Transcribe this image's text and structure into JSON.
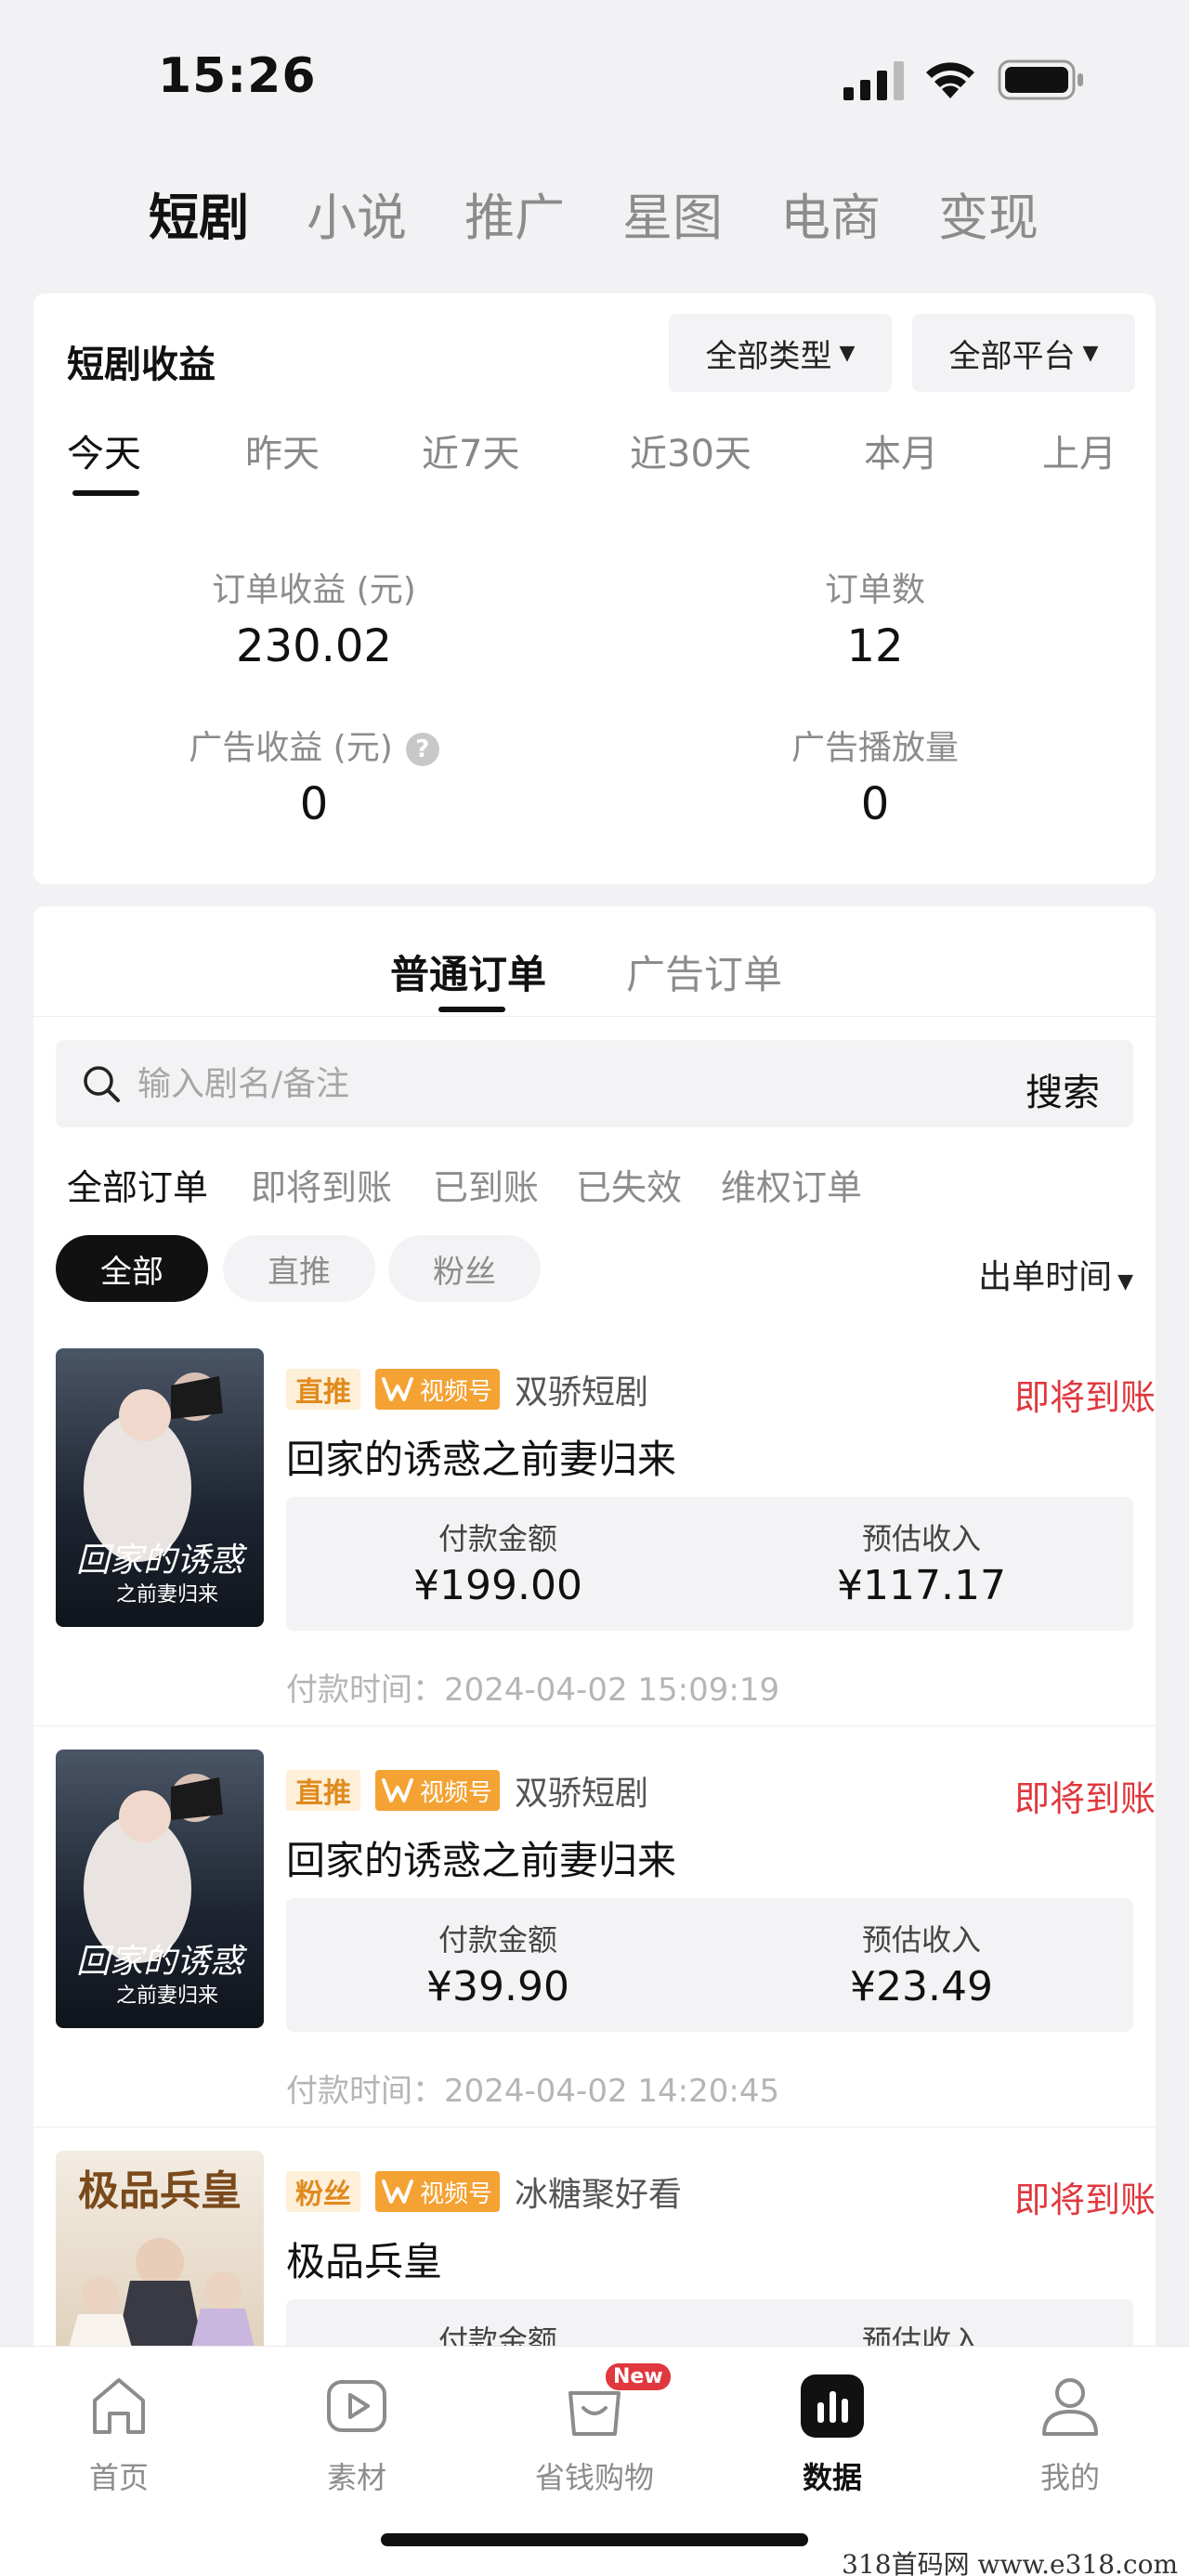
{
  "status_bar": {
    "time": "15:26"
  },
  "top_tabs": [
    "短剧",
    "小说",
    "推广",
    "星图",
    "电商",
    "变现"
  ],
  "earnings": {
    "title": "短剧收益",
    "type_filter": "全部类型",
    "platform_filter": "全部平台",
    "periods": [
      "今天",
      "昨天",
      "近7天",
      "近30天",
      "本月",
      "上月"
    ],
    "order_income_label": "订单收益 (元)",
    "order_income_value": "230.02",
    "order_count_label": "订单数",
    "order_count_value": "12",
    "ad_income_label": "广告收益 (元)",
    "ad_income_value": "0",
    "ad_plays_label": "广告播放量",
    "ad_plays_value": "0"
  },
  "orders": {
    "type_tabs": [
      "普通订单",
      "广告订单"
    ],
    "search_placeholder": "输入剧名/备注",
    "search_button": "搜索",
    "status_filters": [
      "全部订单",
      "即将到账",
      "已到账",
      "已失效",
      "维权订单"
    ],
    "pills": [
      "全部",
      "直推",
      "粉丝"
    ],
    "sort_label": "出单时间",
    "items": [
      {
        "source_tag": "直推",
        "channel": "视频号",
        "merchant": "双骄短剧",
        "status": "即将到账",
        "title": "回家的诱惑之前妻归来",
        "pay_label": "付款金额",
        "pay_amount": "¥199.00",
        "income_label": "预估收入",
        "income_amount": "¥117.17",
        "pay_time": "付款时间：2024-04-02 15:09:19",
        "poster_text_1": "回家的诱惑",
        "poster_text_2": "之前妻归来"
      },
      {
        "source_tag": "直推",
        "channel": "视频号",
        "merchant": "双骄短剧",
        "status": "即将到账",
        "title": "回家的诱惑之前妻归来",
        "pay_label": "付款金额",
        "pay_amount": "¥39.90",
        "income_label": "预估收入",
        "income_amount": "¥23.49",
        "pay_time": "付款时间：2024-04-02 14:20:45",
        "poster_text_1": "回家的诱惑",
        "poster_text_2": "之前妻归来"
      },
      {
        "source_tag": "粉丝",
        "channel": "视频号",
        "merchant": "冰糖聚好看",
        "status": "即将到账",
        "title": "极品兵皇",
        "pay_label": "付款金额",
        "pay_amount": "",
        "income_label": "预估收入",
        "income_amount": "",
        "pay_time": "",
        "poster_text_1": "极品兵皇",
        "poster_text_2": ""
      }
    ]
  },
  "bottom_nav": [
    {
      "label": "首页",
      "icon": "home-icon"
    },
    {
      "label": "素材",
      "icon": "play-icon"
    },
    {
      "label": "省钱购物",
      "icon": "shopping-bag-icon",
      "badge": "New"
    },
    {
      "label": "数据",
      "icon": "chart-icon"
    },
    {
      "label": "我的",
      "icon": "user-icon"
    }
  ],
  "watermark": "318首码网 www.e318.com",
  "colors": {
    "accent_red": "#e0383e",
    "tag_orange": "#f4a233",
    "active_dark": "#111111"
  }
}
